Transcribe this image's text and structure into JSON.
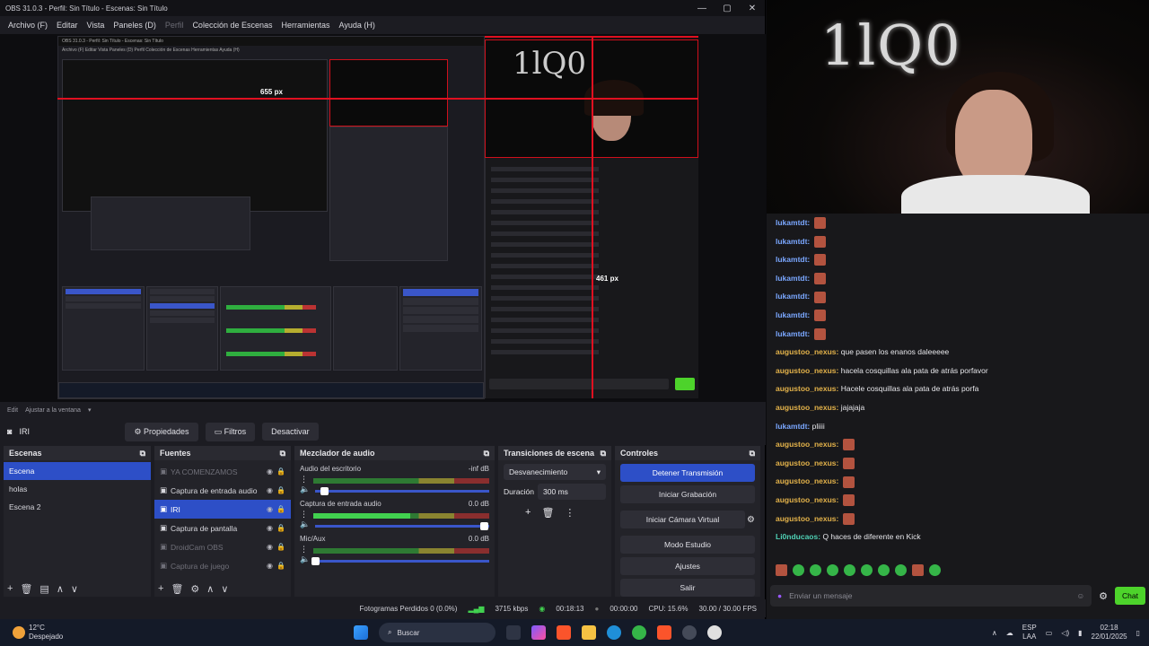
{
  "obs": {
    "title": "OBS 31.0.3 - Perfil: Sin Título - Escenas: Sin Título",
    "menu": [
      "Archivo (F)",
      "Editar",
      "Vista",
      "Paneles (D)",
      "Perfil",
      "Colección de Escenas",
      "Herramientas",
      "Ayuda (H)"
    ],
    "preview": {
      "px_label_1": "655 px",
      "px_label_2": "461 px",
      "nested_title": "OBS 31.0.3 - Perfil: Sin Título - Escenas: Sin Título",
      "nested_menu": "Archivo (F)   Editar   Vista   Paneles (D)   Perfil   Colección de Escenas   Herramientas   Ayuda (H)"
    },
    "scale": {
      "label": "Ajustar a la ventana",
      "prefix": "Edit"
    },
    "source_toolbar": {
      "source_name": "IRI",
      "properties": "Propiedades",
      "filters": "Filtros",
      "deactivate": "Desactivar"
    },
    "scenes": {
      "title": "Escenas",
      "items": [
        "Escena",
        "holas",
        "Escena 2"
      ],
      "selected": 0
    },
    "sources": {
      "title": "Fuentes",
      "items": [
        {
          "name": "YA COMENZAMOS",
          "state": "dim"
        },
        {
          "name": "Captura de entrada audio",
          "state": "normal"
        },
        {
          "name": "IRI",
          "state": "sel"
        },
        {
          "name": "Captura de pantalla",
          "state": "normal"
        },
        {
          "name": "DroidCam OBS",
          "state": "dim"
        },
        {
          "name": "Captura de juego",
          "state": "dim"
        }
      ]
    },
    "mixer": {
      "title": "Mezclador de audio",
      "channels": [
        {
          "name": "Audio del escritorio",
          "db": "-inf dB",
          "level": 0,
          "volume": 0.05
        },
        {
          "name": "Captura de entrada audio",
          "db": "0.0 dB",
          "level": 0.55,
          "volume": 0.97
        },
        {
          "name": "Mic/Aux",
          "db": "0.0 dB",
          "level": 0,
          "volume": 0
        }
      ]
    },
    "transitions": {
      "title": "Transiciones de escena",
      "type": "Desvanecimiento",
      "duration_label": "Duración",
      "duration": "300 ms"
    },
    "controls": {
      "title": "Controles",
      "buttons": [
        "Detener Transmisión",
        "Iniciar Grabación",
        "Iniciar Cámara Virtual",
        "Modo Estudio",
        "Ajustes",
        "Salir"
      ]
    },
    "status": {
      "dropped": "Fotogramas Perdidos 0 (0.0%)",
      "bitrate": "3715 kbps",
      "stream_time": "00:18:13",
      "rec_time": "00:00:00",
      "cpu": "CPU: 15.6%",
      "fps": "30.00 / 30.00 FPS"
    }
  },
  "chat": {
    "messages": [
      {
        "user": "lukamtdt:",
        "text": "",
        "emote": true,
        "color": "#7aa7ff"
      },
      {
        "user": "lukamtdt:",
        "text": "",
        "emote": true,
        "color": "#7aa7ff"
      },
      {
        "user": "lukamtdt:",
        "text": "",
        "emote": true,
        "color": "#7aa7ff"
      },
      {
        "user": "lukamtdt:",
        "text": "",
        "emote": true,
        "color": "#7aa7ff"
      },
      {
        "user": "lukamtdt:",
        "text": "",
        "emote": true,
        "color": "#7aa7ff"
      },
      {
        "user": "lukamtdt:",
        "text": "",
        "emote": true,
        "color": "#7aa7ff"
      },
      {
        "user": "lukamtdt:",
        "text": "",
        "emote": true,
        "color": "#7aa7ff"
      },
      {
        "user": "augustoo_nexus:",
        "text": "que pasen los enanos daleeeee",
        "emote": false,
        "color": "#e3b24a"
      },
      {
        "user": "augustoo_nexus:",
        "text": "hacela cosquillas ala pata de atrás porfavor",
        "emote": false,
        "color": "#e3b24a"
      },
      {
        "user": "augustoo_nexus:",
        "text": "Hacele cosquillas ala pata de atrás porfa",
        "emote": false,
        "color": "#e3b24a"
      },
      {
        "user": "augustoo_nexus:",
        "text": "jajajaja",
        "emote": false,
        "color": "#e3b24a"
      },
      {
        "user": "lukamtdt:",
        "text": "pliiii",
        "emote": false,
        "color": "#7aa7ff"
      },
      {
        "user": "augustoo_nexus:",
        "text": "",
        "emote": true,
        "color": "#e3b24a"
      },
      {
        "user": "augustoo_nexus:",
        "text": "",
        "emote": true,
        "color": "#e3b24a"
      },
      {
        "user": "augustoo_nexus:",
        "text": "",
        "emote": true,
        "color": "#e3b24a"
      },
      {
        "user": "augustoo_nexus:",
        "text": "",
        "emote": true,
        "color": "#e3b24a"
      },
      {
        "user": "augustoo_nexus:",
        "text": "",
        "emote": true,
        "color": "#e3b24a"
      },
      {
        "user": "Li0nducaos:",
        "text": "Q haces de diferente en Kick",
        "emote": false,
        "color": "#4fd1b5"
      }
    ],
    "input_placeholder": "Enviar un mensaje",
    "send": "Chat"
  },
  "taskbar": {
    "temp": "12°C",
    "weather": "Despejado",
    "search": "Buscar",
    "lang_1": "ESP",
    "lang_2": "LAA",
    "time": "02:18",
    "date": "22/01/2025"
  },
  "colors": {
    "accent": "#2d4fc7",
    "record_red": "#e01020",
    "chat_green": "#4dd32b"
  }
}
